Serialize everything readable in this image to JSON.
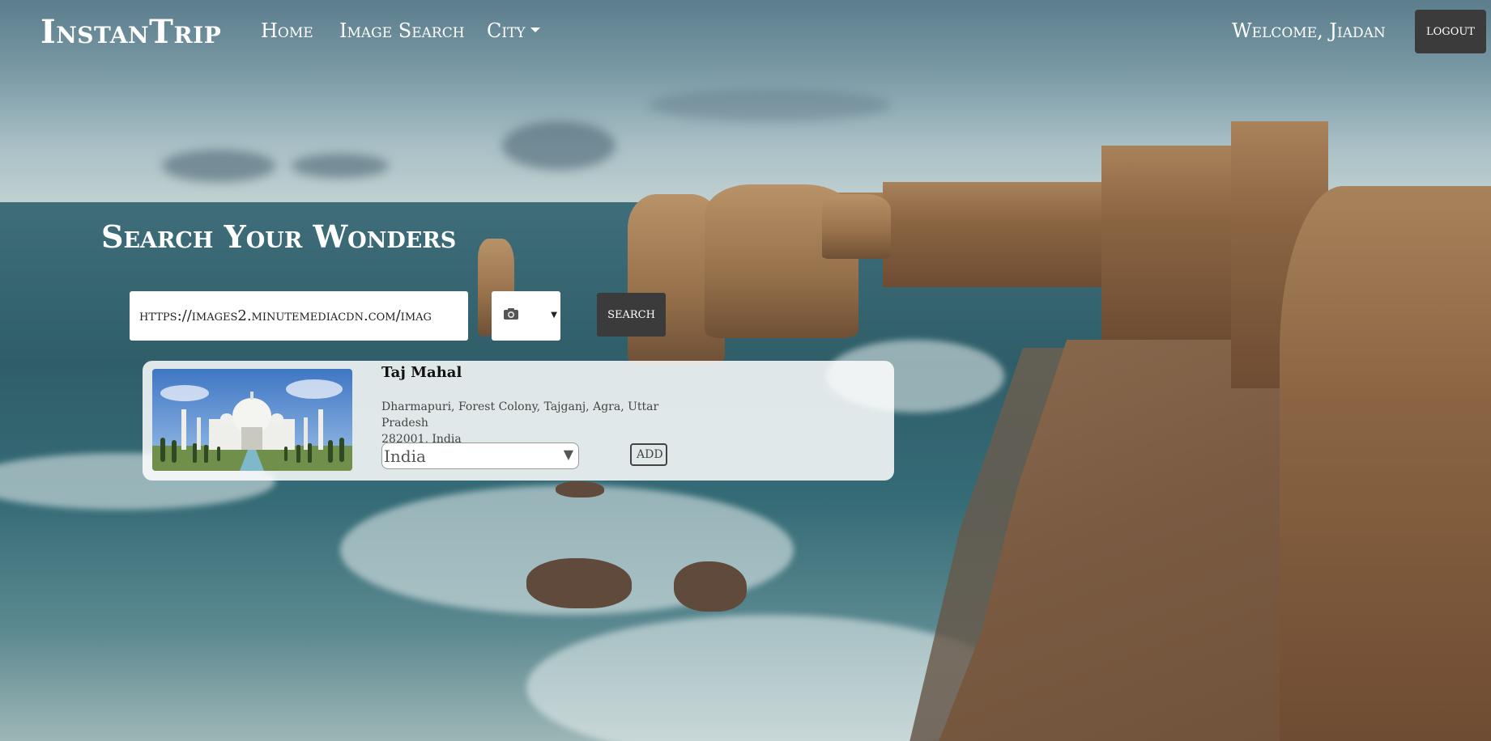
{
  "navbar": {
    "brand": "InstanTrip",
    "links": {
      "home": "Home",
      "image_search": "Image Search",
      "city": "City"
    },
    "welcome": "Welcome, Jiadan",
    "logout_label": "LOGOUT"
  },
  "hero": {
    "title": "Search Your Wonders",
    "search_input_value": "https://images2.minutemediacdn.com/imag",
    "image_picker_icon": "camera-icon",
    "search_label": "SEARCH"
  },
  "result": {
    "name": "Taj Mahal",
    "address_line1": "Dharmapuri, Forest Colony, Tajganj, Agra, Uttar Pradesh",
    "address_line2": "282001, India",
    "country_selected": "India",
    "add_label": "ADD"
  },
  "colors": {
    "button_bg": "#3b3b3b",
    "nav_text": "#ffffff",
    "card_bg": "rgba(255,255,255,0.85)"
  }
}
